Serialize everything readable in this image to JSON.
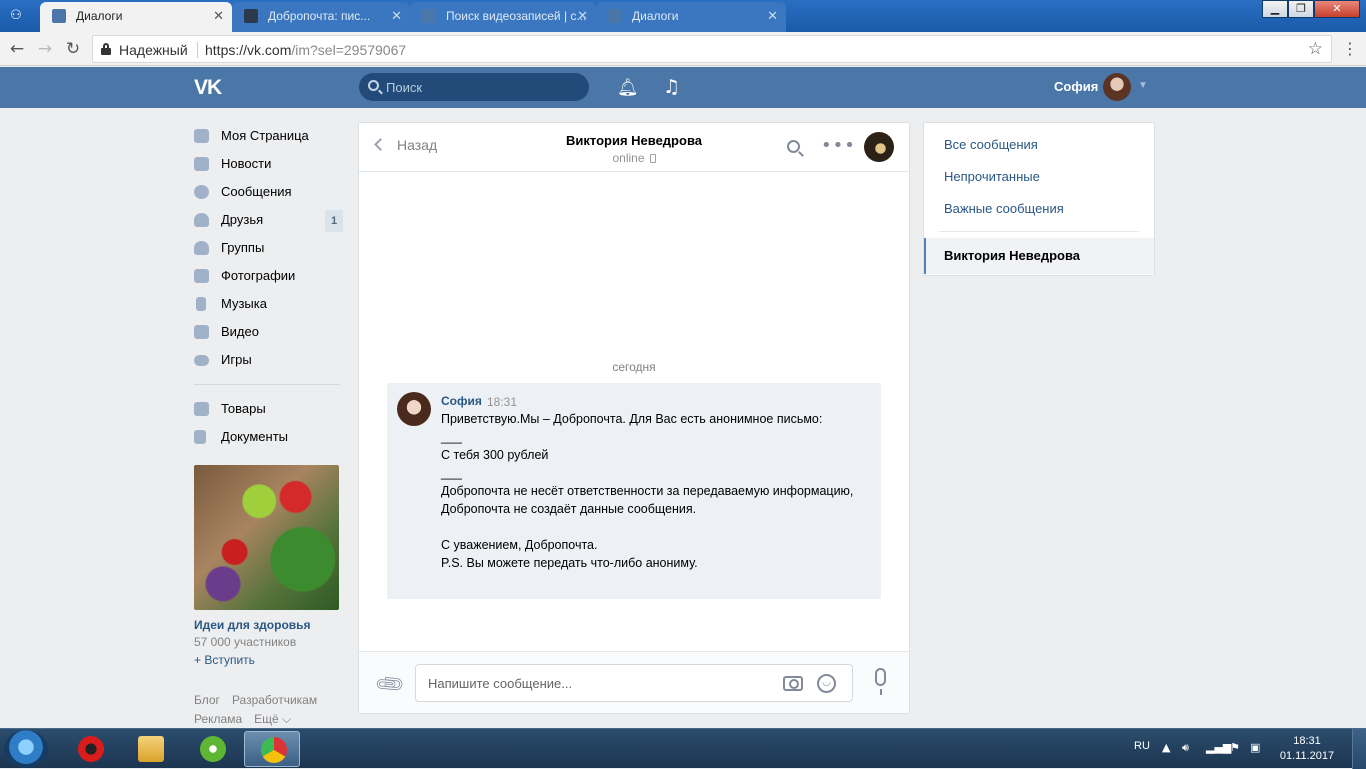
{
  "browser": {
    "tabs": [
      {
        "title": "Диалоги",
        "active": true
      },
      {
        "title": "Добропочта: пис...",
        "active": false
      },
      {
        "title": "Поиск видеозаписей | с...",
        "active": false
      },
      {
        "title": "Диалоги",
        "active": false
      }
    ],
    "secure_label": "Надежный",
    "url_host": "https://vk.com",
    "url_path": "/im?sel=29579067",
    "tab_close": "✕"
  },
  "header": {
    "logo": "VK",
    "search_placeholder": "Поиск",
    "user_name": "София",
    "icons": [
      "bell-icon",
      "music-icon"
    ]
  },
  "left_menu": {
    "items": [
      {
        "label": "Моя Страница",
        "icon": "home-icon"
      },
      {
        "label": "Новости",
        "icon": "news-icon"
      },
      {
        "label": "Сообщения",
        "icon": "messages-icon"
      },
      {
        "label": "Друзья",
        "icon": "friends-icon",
        "badge": "1"
      },
      {
        "label": "Группы",
        "icon": "groups-icon"
      },
      {
        "label": "Фотографии",
        "icon": "photo-icon"
      },
      {
        "label": "Музыка",
        "icon": "music-icon"
      },
      {
        "label": "Видео",
        "icon": "video-icon"
      },
      {
        "label": "Игры",
        "icon": "games-icon"
      }
    ],
    "extra": [
      {
        "label": "Товары",
        "icon": "market-icon"
      },
      {
        "label": "Документы",
        "icon": "docs-icon"
      }
    ],
    "promo": {
      "title": "Идеи для здоровья",
      "members": "57 000 участников",
      "join": "+ Вступить"
    },
    "footer": {
      "blog": "Блог",
      "dev": "Разработчикам",
      "ads": "Реклама",
      "more": "Ещё ⌵"
    }
  },
  "chat": {
    "back_label": "Назад",
    "peer_name": "Виктория Неведрова",
    "peer_status": "online",
    "day_label": "сегодня",
    "message": {
      "author": "София",
      "time": "18:31",
      "text": "Приветствую.Мы – Добропочта. Для Вас есть анонимное письмо:\n___\nС тебя 300 рублей\n___\nДобропочта не несёт ответственности за передаваемую информацию, Добропочта не создаёт данные сообщения.\n\nС уважением, Добропочта.\nP.S. Вы можете передать что-либо анониму."
    },
    "compose_placeholder": "Напишите сообщение..."
  },
  "filters": {
    "all": "Все сообщения",
    "unread": "Непрочитанные",
    "important": "Важные сообщения",
    "selected_dialog": "Виктория Неведрова"
  },
  "taskbar": {
    "lang": "RU",
    "time": "18:31",
    "date": "01.11.2017"
  },
  "colors": {
    "vk_blue": "#4a76a8",
    "link": "#2a5885",
    "background": "#edeef0"
  }
}
